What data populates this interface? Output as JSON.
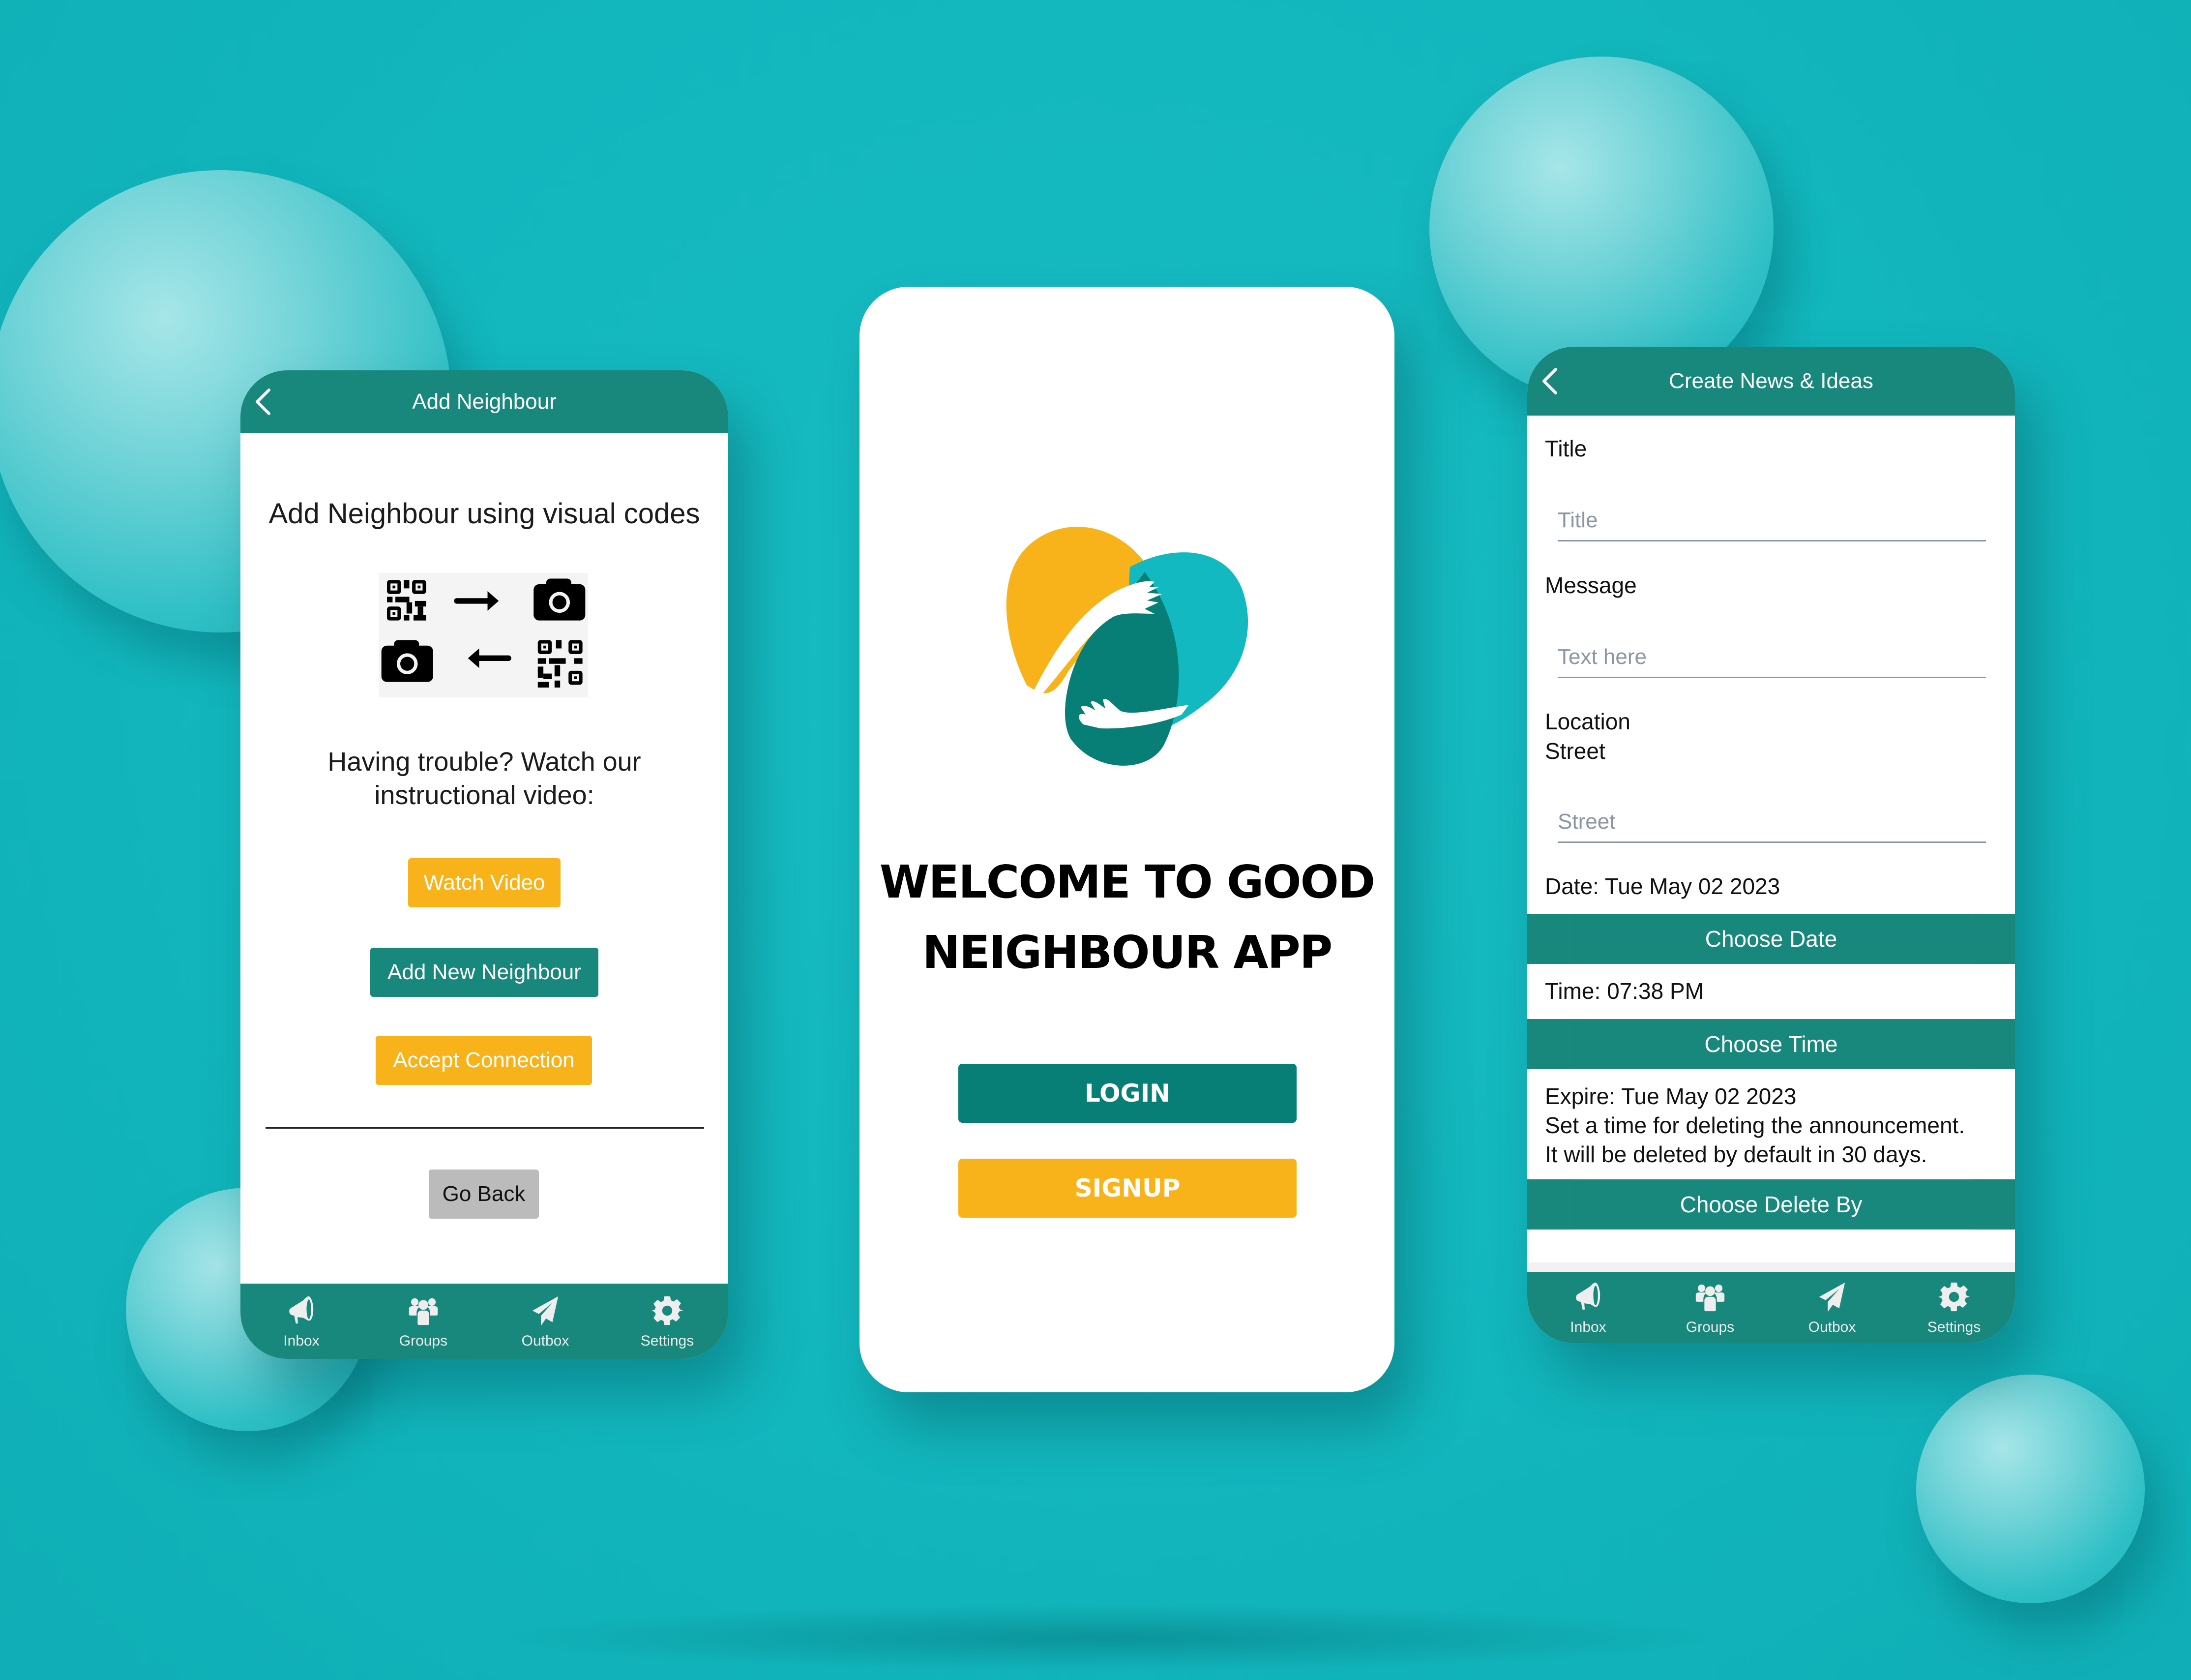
{
  "colors": {
    "background": "#12b6bd",
    "teal": "#18877c",
    "teal_dark": "#077f76",
    "yellow": "#f9b31a",
    "logo_cyan": "#13b9c1",
    "grey_button": "#bbbbbb",
    "placeholder": "#8a96a3"
  },
  "left_screen": {
    "header_title": "Add Neighbour",
    "heading": "Add Neighbour using visual codes",
    "qr_graphic": [
      "qr-code-icon",
      "arrow-right-icon",
      "camera-icon",
      "camera-icon",
      "arrow-left-icon",
      "qr-code-icon"
    ],
    "help_text_line1": "Having trouble? Watch our",
    "help_text_line2": "instructional video:",
    "watch_video": "Watch Video",
    "add_new_neighbour": "Add New Neighbour",
    "accept_connection": "Accept Connection",
    "go_back": "Go Back"
  },
  "center_screen": {
    "welcome_line1": "WELCOME TO GOOD",
    "welcome_line2": "NEIGHBOUR APP",
    "login": "LOGIN",
    "signup": "SIGNUP"
  },
  "right_screen": {
    "header_title": "Create News & Ideas",
    "title_label": "Title",
    "title_placeholder": "Title",
    "title_value": "",
    "message_label": "Message",
    "message_placeholder": "Text here",
    "message_value": "",
    "location_label": "Location",
    "street_label": "Street",
    "street_placeholder": "Street",
    "street_value": "",
    "date_text": "Date: Tue May 02 2023",
    "choose_date": "Choose Date",
    "time_text": "Time: 07:38 PM",
    "choose_time": "Choose Time",
    "expire_text": "Expire: Tue May 02 2023",
    "expire_note1": "Set a time for deleting the announcement.",
    "expire_note2": "It will be deleted by default in 30 days.",
    "choose_delete_by": "Choose Delete By"
  },
  "tabbar": [
    {
      "label": "Inbox",
      "icon": "megaphone-icon"
    },
    {
      "label": "Groups",
      "icon": "users-icon"
    },
    {
      "label": "Outbox",
      "icon": "paper-plane-icon"
    },
    {
      "label": "Settings",
      "icon": "gear-icon"
    }
  ]
}
